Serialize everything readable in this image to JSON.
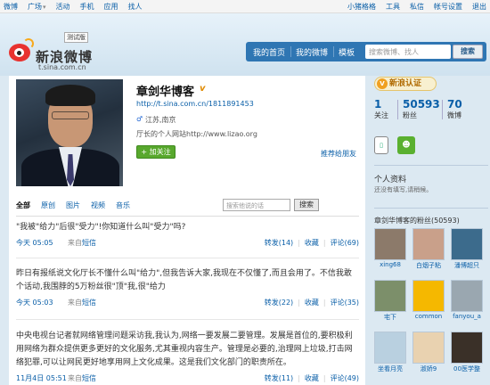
{
  "topbar": {
    "left": [
      "微博",
      "广场",
      "活动",
      "手机",
      "应用",
      "找人"
    ],
    "right": [
      "小猪格格",
      "工具",
      "私信",
      "帐号设置",
      "退出"
    ]
  },
  "header": {
    "logo_text": "新浪微博",
    "logo_url": "t.sina.com.cn",
    "beta": "测试版",
    "nav": [
      "我的首页",
      "我的微博",
      "模板"
    ],
    "search_placeholder": "搜索微博、找人",
    "search_button": "搜索"
  },
  "profile": {
    "name": "章剑华博客",
    "verified_mark": "v",
    "url": "http://t.sina.com.cn/1811891453",
    "gender_icon": "♂",
    "location": "江苏,南京",
    "description": "厅长的个人网站http://www.lizao.org",
    "follow_button": "+ 加关注",
    "recommend_link": "推荐给朋友"
  },
  "feed": {
    "tabs": [
      "全部",
      "原创",
      "图片",
      "视频",
      "音乐"
    ],
    "search_placeholder": "搜索他说的话",
    "search_button": "搜索"
  },
  "posts": [
    {
      "text": "\"我被\"给力\"后很\"受力\"!你知道什么叫\"受力\"吗?",
      "time": "今天 05:05",
      "source_prefix": "来自",
      "source": "短信",
      "forward": "转发(14)",
      "fav": "收藏",
      "comment": "评论(69)"
    },
    {
      "text": "昨日有报纸说文化厅长不懂什么叫\"给力\",但我告诉大家,我现在不仅懂了,而且会用了。不信我敢个话动,我围脖的5万粉丝很\"顶\"我,很\"给力",
      "time": "今天 05:03",
      "source_prefix": "来自",
      "source": "短信",
      "forward": "转发(22)",
      "fav": "收藏",
      "comment": "评论(35)"
    },
    {
      "text": "中央电视台记者就网络管理问题采访我,我认为,网络一要发展二要管理。发展是首位的,要积极利用网络为群众提供更多更好的文化服务,尤其重视内容生产。管理是必要的,治理网上垃圾,打击网络犯罪,可以让网民更好地享用网上文化成果。这是我们文化部门的职责所在。",
      "time": "11月4日 05:51",
      "source_prefix": "来自",
      "source": "短信",
      "forward": "转发(11)",
      "fav": "收藏",
      "comment": "评论(49)"
    }
  ],
  "sidebar": {
    "auth": "新浪认证",
    "stats": [
      {
        "num": "1",
        "label": "关注"
      },
      {
        "num": "50593",
        "label": "粉丝"
      },
      {
        "num": "70",
        "label": "微博"
      }
    ],
    "profile_title": "个人资料",
    "profile_empty": "还没有填写,请稍候。",
    "fans_title": "章剑华博客的粉丝(50593)",
    "fans": [
      {
        "name": "xing68",
        "color": "#8c7a6a"
      },
      {
        "name": "白烟子粘",
        "color": "#c9a08a"
      },
      {
        "name": "潘博超只",
        "color": "#3c6b8c"
      },
      {
        "name": "宅下",
        "color": "#7c8f6a"
      },
      {
        "name": "common",
        "color": "#f5b800"
      },
      {
        "name": "fanyou_a",
        "color": "#9aa7b0"
      },
      {
        "name": "坐看月亮",
        "color": "#b9d0e0"
      },
      {
        "name": "淑娇9",
        "color": "#e9d2b0"
      },
      {
        "name": "00医学整",
        "color": "#3a3028"
      }
    ]
  }
}
